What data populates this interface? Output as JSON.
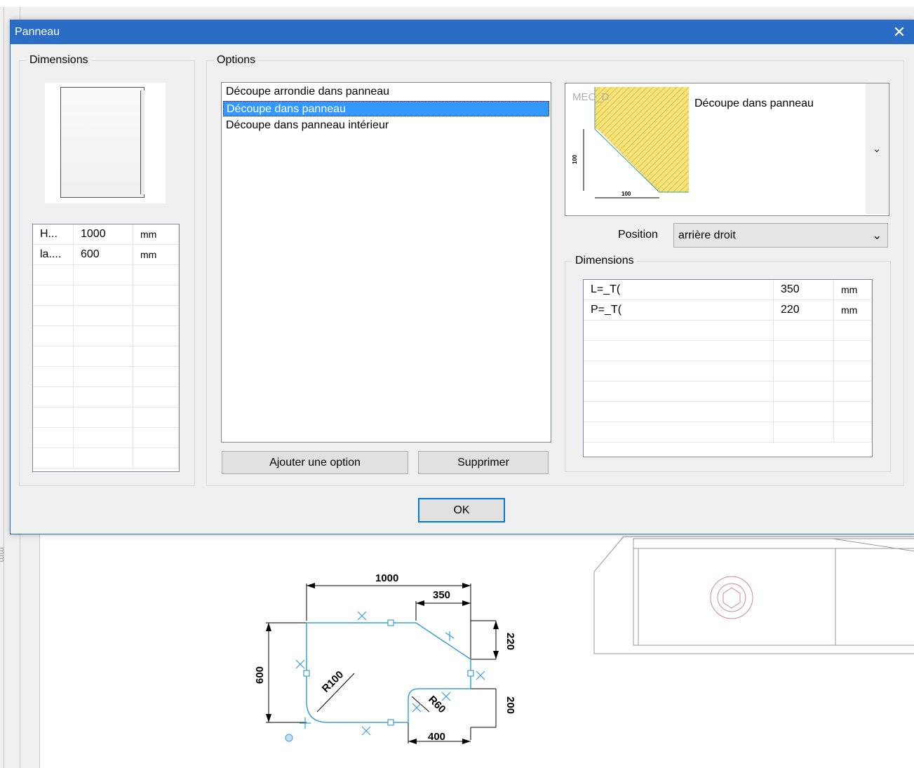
{
  "dialog": {
    "title": "Panneau",
    "close_glyph": "✕"
  },
  "dimensions_group": {
    "legend": "Dimensions",
    "rows": [
      {
        "name": "H...",
        "value": "1000",
        "unit": "mm"
      },
      {
        "name": "la....",
        "value": "600",
        "unit": "mm"
      }
    ]
  },
  "options_group": {
    "legend": "Options",
    "items": [
      {
        "label": "Découpe arrondie dans panneau",
        "selected": false
      },
      {
        "label": "Découpe dans panneau",
        "selected": true
      },
      {
        "label": "Découpe dans panneau intérieur",
        "selected": false
      }
    ],
    "add_button": "Ajouter une option",
    "delete_button": "Supprimer"
  },
  "option_preview": {
    "image_label": "MEC_D",
    "description": "Découpe dans panneau",
    "dropdown_icon": "chevron-down-icon",
    "drawing_dims": {
      "horizontal": "100",
      "vertical": "100"
    }
  },
  "position": {
    "label": "Position",
    "selected": "arrière droit"
  },
  "option_dimensions": {
    "legend": "Dimensions",
    "rows": [
      {
        "name": "L=_T(",
        "value": "350",
        "unit": "mm"
      },
      {
        "name": "P=_T(",
        "value": "220",
        "unit": "mm"
      }
    ]
  },
  "ok_button": "OK",
  "canvas": {
    "ruler_unit": "mm",
    "dims": {
      "width": "1000",
      "cut_width": "350",
      "cut_depth": "220",
      "height": "600",
      "radius_big": "R100",
      "radius_small": "R60",
      "bottom_right_depth": "200",
      "bottom_width": "400"
    }
  },
  "colors": {
    "accent": "#2b6cc4",
    "selection": "#3399ff",
    "cad_line": "#3aa0d8",
    "hatch": "#f2d24b"
  }
}
